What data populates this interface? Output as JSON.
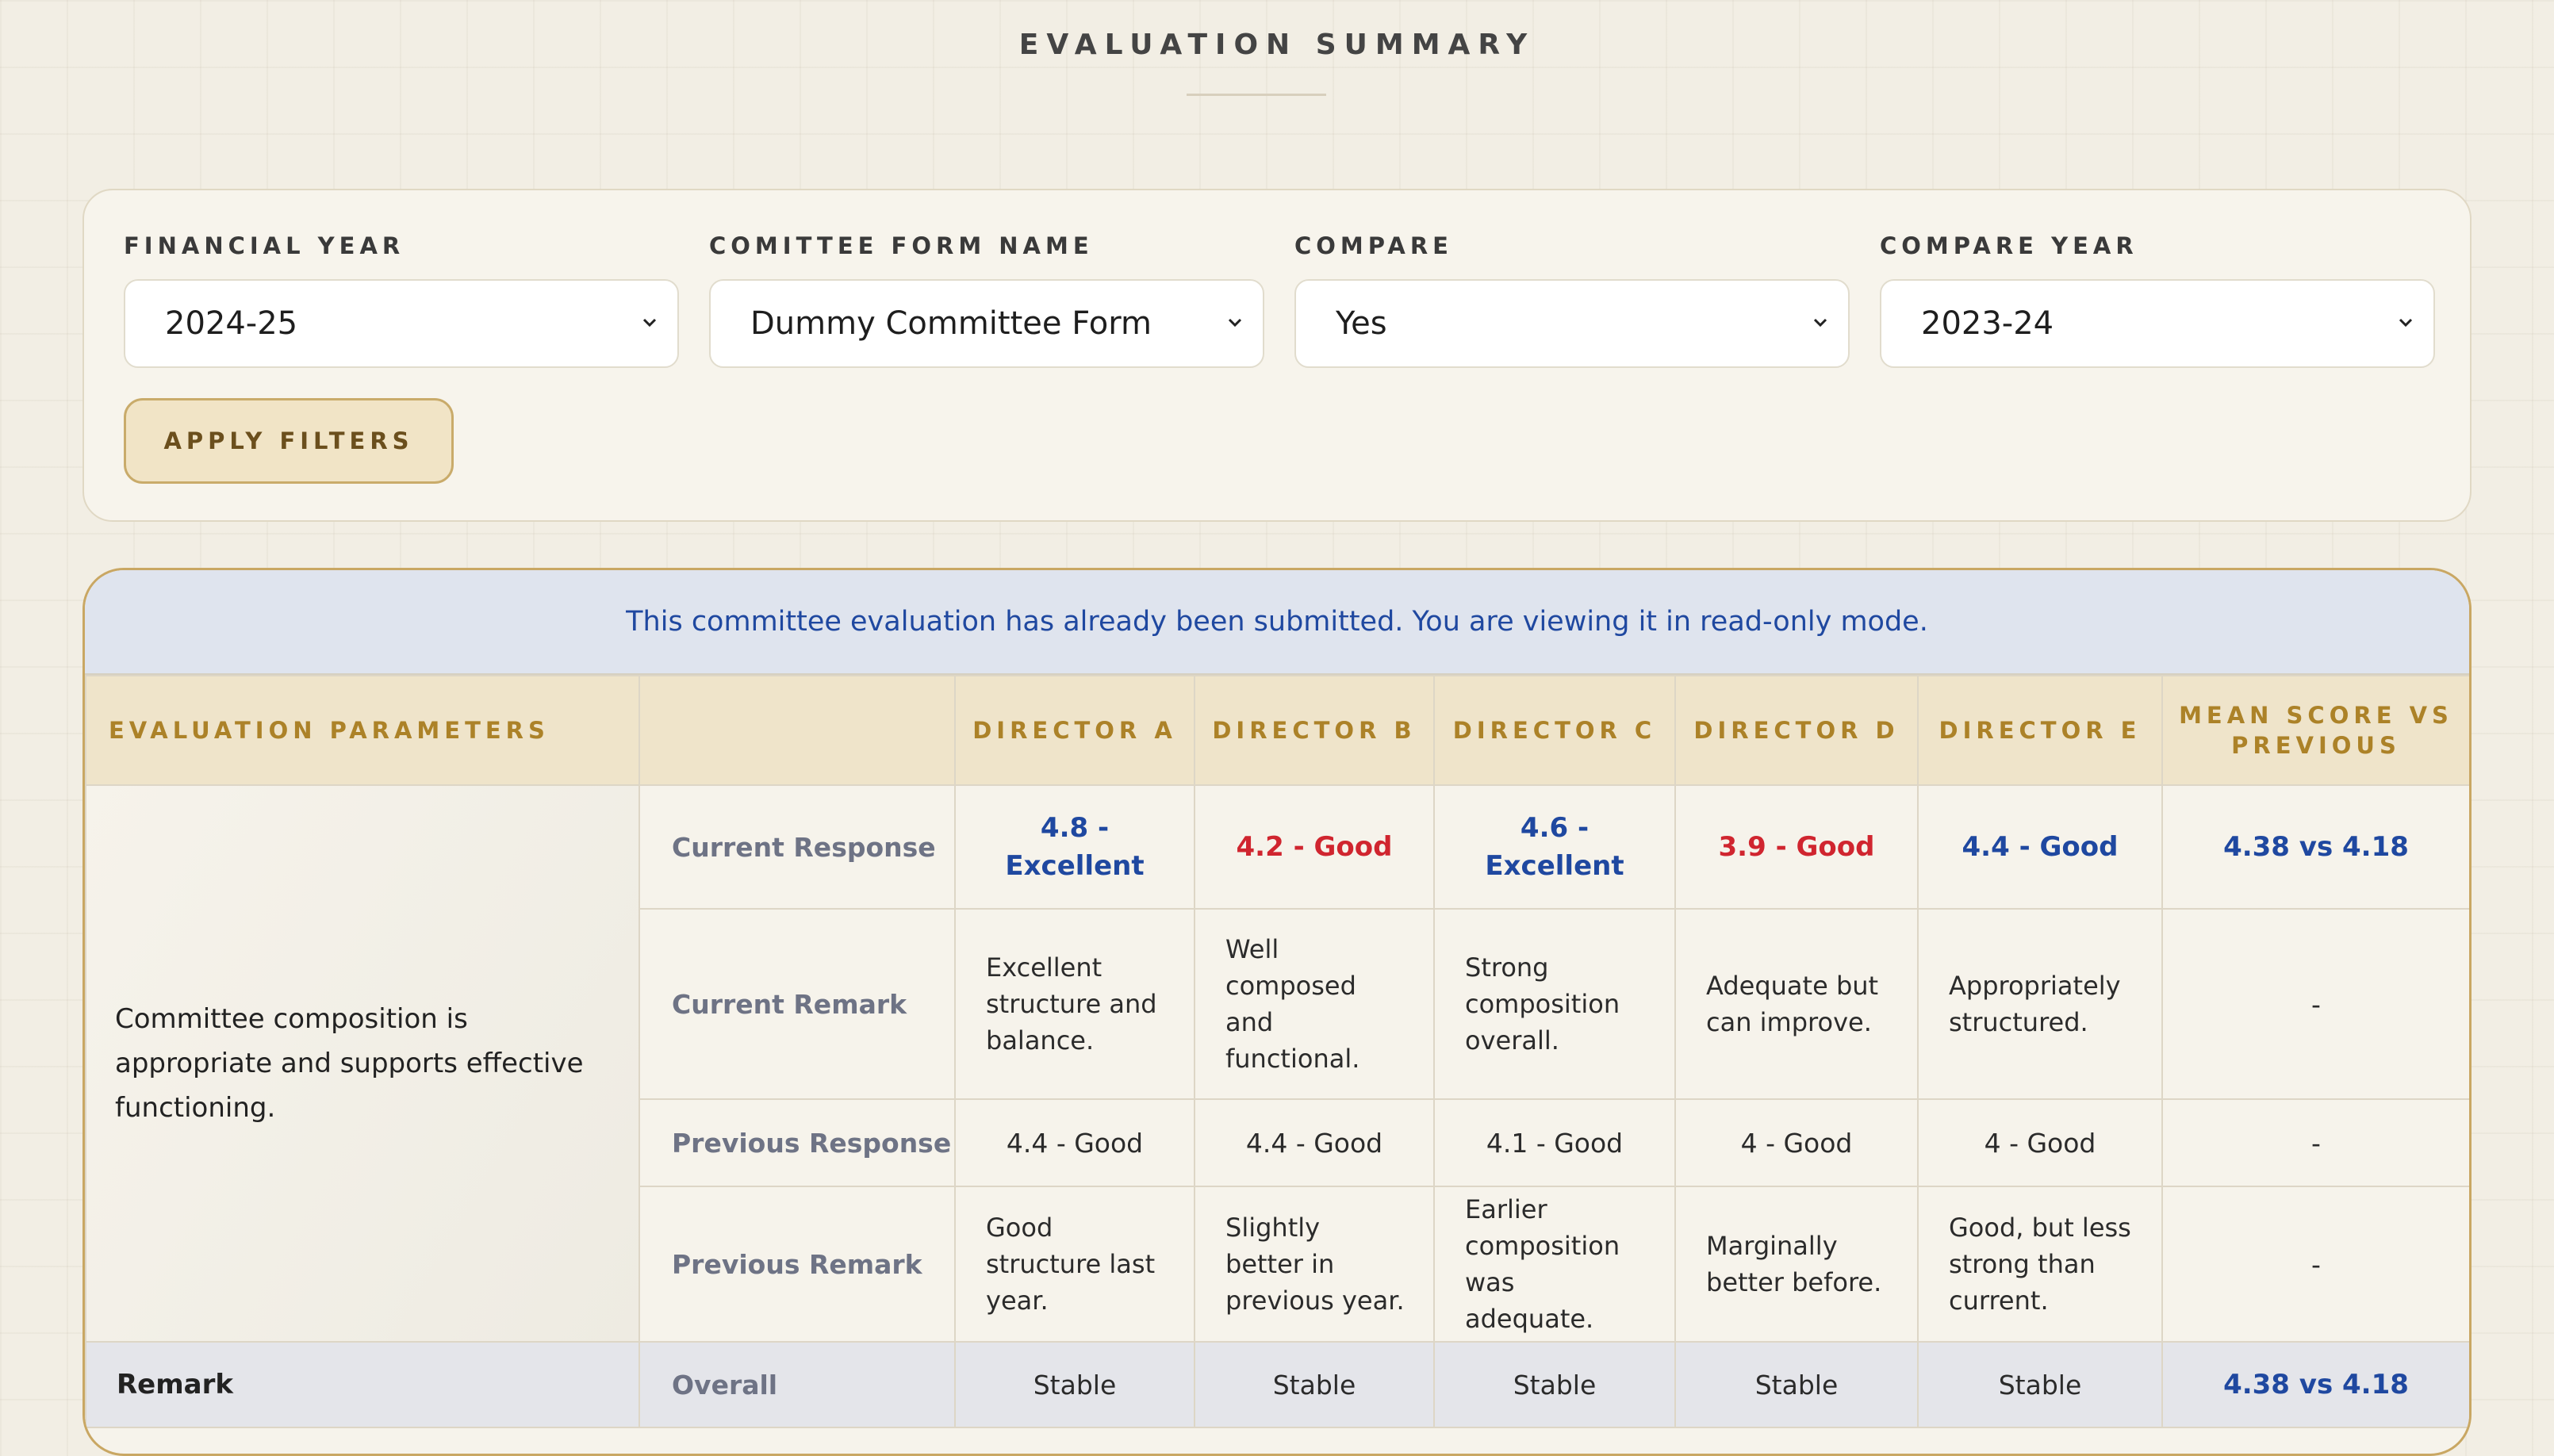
{
  "page": {
    "title": "EVALUATION SUMMARY"
  },
  "filters": {
    "financial_year": {
      "label": "FINANCIAL YEAR",
      "value": "2024-25"
    },
    "committee_form": {
      "label": "COMITTEE FORM NAME",
      "value": "Dummy Committee Form"
    },
    "compare": {
      "label": "COMPARE",
      "value": "Yes"
    },
    "compare_year": {
      "label": "COMPARE YEAR",
      "value": "2023-24"
    },
    "apply_label": "APPLY FILTERS"
  },
  "notice": "This committee evaluation has already been submitted. You are viewing it in read-only mode.",
  "table": {
    "headers": {
      "param": "EVALUATION PARAMETERS",
      "blank": "",
      "directors": [
        "DIRECTOR A",
        "DIRECTOR B",
        "DIRECTOR C",
        "DIRECTOR D",
        "DIRECTOR E"
      ],
      "mean": "MEAN SCORE VS PREVIOUS"
    },
    "parameter": "Committee composition is appropriate and supports effective functioning.",
    "rows": {
      "current_response": {
        "label": "Current Response",
        "values": [
          "4.8 - Excellent",
          "4.2 - Good",
          "4.6 - Excellent",
          "3.9 - Good",
          "4.4 - Good"
        ],
        "mean": "4.38 vs 4.18"
      },
      "current_remark": {
        "label": "Current Remark",
        "values": [
          "Excellent structure and balance.",
          "Well composed and functional.",
          "Strong composition overall.",
          "Adequate but can improve.",
          "Appropriately structured."
        ],
        "mean": "-"
      },
      "previous_response": {
        "label": "Previous Response",
        "values": [
          "4.4 - Good",
          "4.4 - Good",
          "4.1 - Good",
          "4 - Good",
          "4 - Good"
        ],
        "mean": "-"
      },
      "previous_remark": {
        "label": "Previous Remark",
        "values": [
          "Good structure last year.",
          "Slightly better in previous year.",
          "Earlier composition was adequate.",
          "Marginally better before.",
          "Good, but less strong than current."
        ],
        "mean": "-"
      },
      "remark": {
        "title": "Remark",
        "label": "Overall",
        "values": [
          "Stable",
          "Stable",
          "Stable",
          "Stable",
          "Stable"
        ],
        "mean": "4.38 vs 4.18"
      }
    }
  },
  "colors": {
    "accent_gold": "#ac8228",
    "score_blue": "#1f48a0",
    "score_red": "#d0252f",
    "notice_bg": "#dfe4ee"
  },
  "icons": {
    "select_arrow": "chevron-down-icon"
  }
}
